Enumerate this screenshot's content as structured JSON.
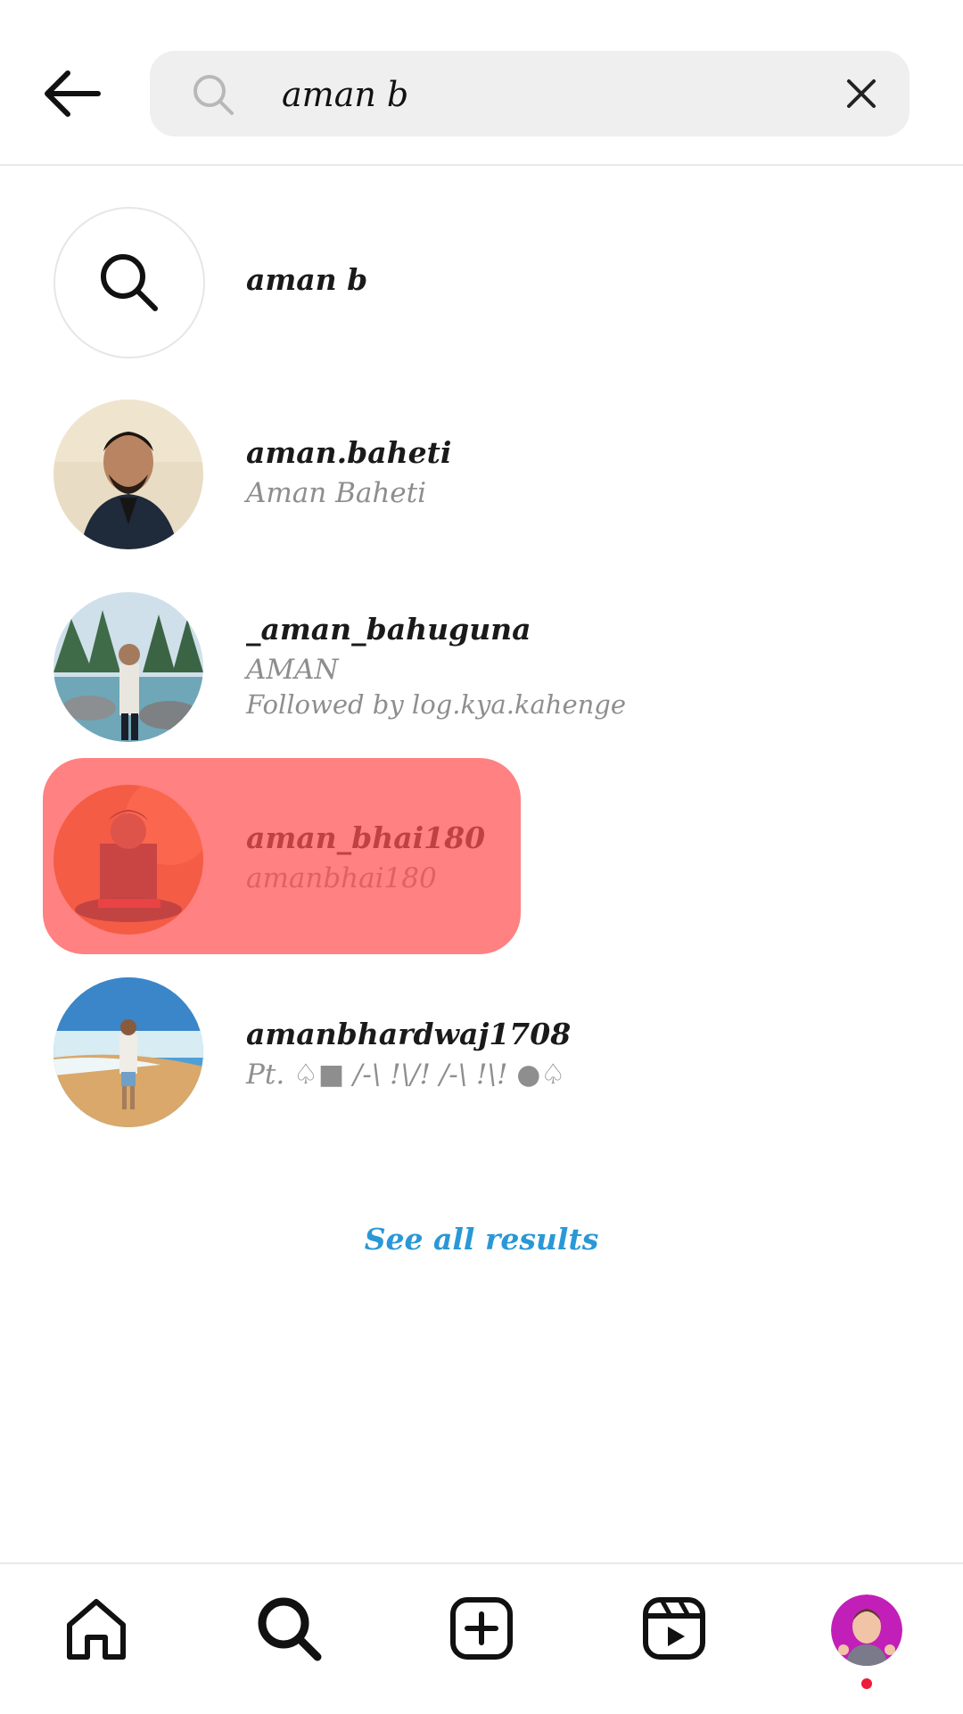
{
  "search": {
    "query": "aman b",
    "placeholder": "Search"
  },
  "suggestion": {
    "label": "aman b",
    "icon": "search-icon"
  },
  "results": [
    {
      "username": "aman.baheti",
      "name": "Aman Baheti",
      "extra": ""
    },
    {
      "username": "_aman_bahuguna",
      "name": "AMAN",
      "extra": "Followed by log.kya.kahenge"
    },
    {
      "username": "aman_bhai180",
      "name": "amanbhai180",
      "extra": ""
    },
    {
      "username": "amanbhardwaj1708",
      "name": "Pt. ♤■ /-\\ !\\/! /-\\ !\\! ●♤",
      "extra": ""
    }
  ],
  "see_all_label": "See all results",
  "nav": {
    "items": [
      "home-icon",
      "search-icon",
      "create-post-icon",
      "reels-icon",
      "profile-avatar"
    ]
  },
  "colors": {
    "link": "#2a98d6",
    "highlight": "#ff5050",
    "notification_dot": "#ed1c3a"
  }
}
